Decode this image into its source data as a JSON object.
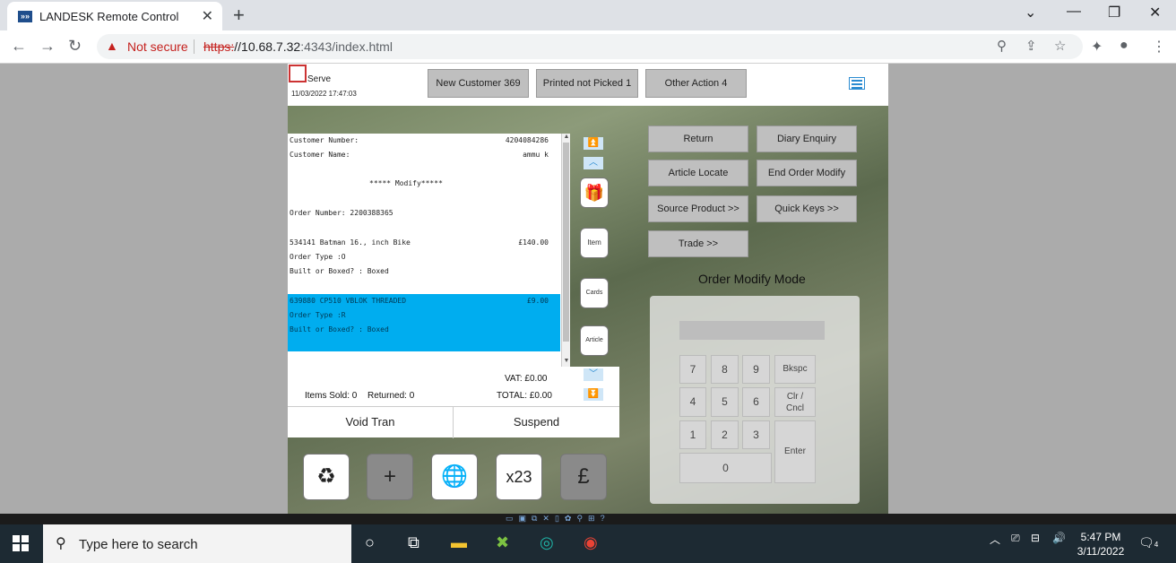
{
  "browser": {
    "tab_title": "LANDESK Remote Control",
    "tab_favicon": "»»",
    "security_label": "Not secure",
    "url_scheme": "https:",
    "url_host": "//10.68.7.32",
    "url_rest": ":4343/index.html"
  },
  "app": {
    "serve_label": "Serve",
    "datetime": "11/03/2022 17:47:03",
    "header_buttons": [
      "New Customer 369",
      "Printed not Picked 1",
      "Other Action 4"
    ],
    "receipt": {
      "customer_number_label": "Customer Number:",
      "customer_number": "4204084286",
      "customer_name_label": "Customer Name:",
      "customer_name": "ammu k",
      "modify_banner": "***** Modify*****",
      "order_number_line": "Order Number: 2200388365",
      "items": [
        {
          "desc": "534141 Batman 16., inch Bike",
          "price": "£140.00",
          "order_type": "Order Type :O",
          "built": "Built or Boxed? : Boxed"
        },
        {
          "desc": "639880 CP510 VBLOK THREADED",
          "price": "£9.00",
          "order_type": "Order Type :R",
          "built": "Built or Boxed? : Boxed"
        }
      ]
    },
    "totals": {
      "vat": "VAT: £0.00",
      "items_sold": "Items Sold: 0",
      "returned": "Returned: 0",
      "total": "TOTAL: £0.00"
    },
    "void_label": "Void Tran",
    "suspend_label": "Suspend",
    "right_buttons": [
      "Return",
      "Diary Enquiry",
      "Article Locate",
      "End Order Modify",
      "Source Product >>",
      "Quick Keys >>",
      "Trade >>"
    ],
    "mode_label": "Order Modify Mode",
    "keypad": {
      "digits": [
        "7",
        "8",
        "9",
        "4",
        "5",
        "6",
        "1",
        "2",
        "3",
        "0"
      ],
      "bkspc": "Bkspc",
      "clr": "Clr /",
      "cncl": "Cncl",
      "enter": "Enter"
    },
    "side_icon_labels": [
      "Item",
      "Cards",
      "Article"
    ],
    "bottom_icon_glyphs": [
      "♻",
      "+",
      "🌐",
      "x23",
      "£"
    ]
  },
  "taskbar": {
    "search_placeholder": "Type here to search",
    "time": "5:47 PM",
    "date": "3/11/2022",
    "notification_count": "4"
  }
}
